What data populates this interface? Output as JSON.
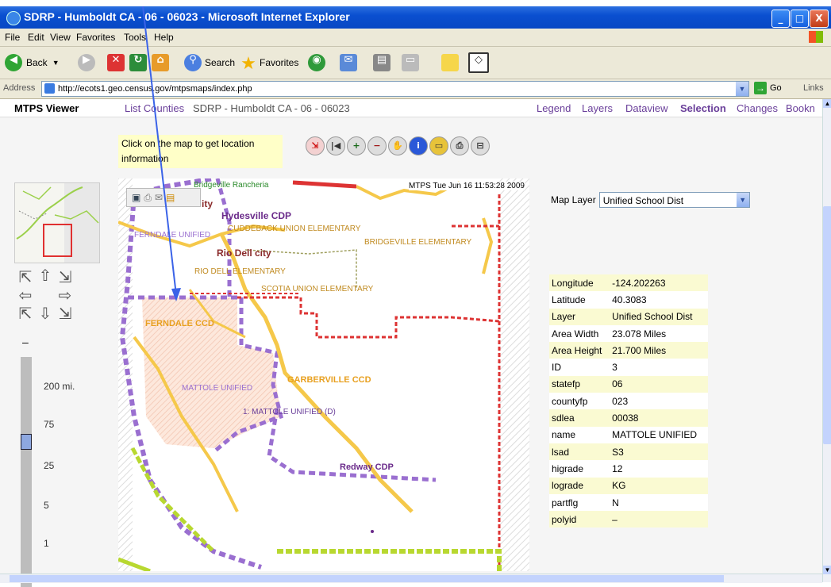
{
  "window": {
    "title": "SDRP - Humboldt CA - 06 - 06023 - Microsoft Internet Explorer",
    "minimize": "_",
    "maximize": "□",
    "close": "X"
  },
  "menubar": {
    "file": "File",
    "edit": "Edit",
    "view": "View",
    "favorites": "Favorites",
    "tools": "Tools",
    "help": "Help"
  },
  "toolbar": {
    "back": "Back",
    "search": "Search",
    "favorites": "Favorites"
  },
  "address": {
    "label": "Address",
    "url": "http://ecots1.geo.census.gov/mtpsmaps/index.php",
    "go": "Go",
    "links": "Links"
  },
  "nav": {
    "brand": "MTPS Viewer",
    "list_counties": "List Counties",
    "crumb": "SDRP - Humboldt CA - 06 - 06023",
    "legend": "Legend",
    "layers": "Layers",
    "dataview": "Dataview",
    "selection": "Selection",
    "changes": "Changes",
    "bookmarks": "Bookn"
  },
  "hint": "Click on the map to get location information",
  "tools": [
    "zoom-extent-icon",
    "previous-extent-icon",
    "zoom-in-icon",
    "zoom-out-icon",
    "pan-hand-icon",
    "identify-info-icon",
    "measure-icon",
    "print-icon",
    "clear-icon"
  ],
  "scales": [
    "200 mi.",
    "75",
    "25",
    "5",
    "1"
  ],
  "zoom_minus": "–",
  "zoom_level_fraction": 0.35,
  "map": {
    "timestamp": "MTPS Tue Jun 16 11:53:28 2009",
    "labels": {
      "hydesville": "Hydesville CDP",
      "city": "ity",
      "rancheria": "Bridgeville Rancheria",
      "cuddeback": "CUDDEBACK UNION ELEMENTARY",
      "bridgeville": "BRIDGEVILLE ELEMENTARY",
      "ferndale_unified": "FERNDALE UNIFIED",
      "rio_dell_city": "Rio Dell city",
      "rio_dell_elem": "RIO DELL ELEMENTARY",
      "scotia": "SCOTIA UNION ELEMENTARY",
      "ferndale_ccd": "FERNDALE CCD",
      "garberville_ccd": "GARBERVILLE CCD",
      "mattole_unified": "MATTOLE UNIFIED",
      "mattole_selected": "1: MATTOLE UNIFIED (D)",
      "redway": "Redway CDP"
    }
  },
  "map_layer": {
    "label": "Map Layer",
    "value": "Unified School Dist"
  },
  "info_rows": [
    {
      "k": "Longitude",
      "v": "-124.202263"
    },
    {
      "k": "Latitude",
      "v": "40.3083"
    },
    {
      "k": "Layer",
      "v": "Unified School Dist"
    },
    {
      "k": "Area Width",
      "v": "23.078 Miles"
    },
    {
      "k": "Area Height",
      "v": "21.700 Miles"
    },
    {
      "k": "ID",
      "v": "3"
    },
    {
      "k": "statefp",
      "v": "06"
    },
    {
      "k": "countyfp",
      "v": "023"
    },
    {
      "k": "sdlea",
      "v": "00038"
    },
    {
      "k": "name",
      "v": "MATTOLE UNIFIED"
    },
    {
      "k": "lsad",
      "v": "S3"
    },
    {
      "k": "higrade",
      "v": "12"
    },
    {
      "k": "lograde",
      "v": "KG"
    },
    {
      "k": "partflg",
      "v": "N"
    },
    {
      "k": "polyid",
      "v": "–"
    }
  ],
  "colors": {
    "accent": "#6a3f9a",
    "title_bar": "#0a4fd0",
    "hint_bg": "#ffffc8",
    "ccd_label": "#e8a020",
    "cdp_label": "#6a2a8a",
    "boundary_purple": "#9a6fd0",
    "road_yellow": "#f5c84a",
    "arrow": "#3b63e8"
  }
}
